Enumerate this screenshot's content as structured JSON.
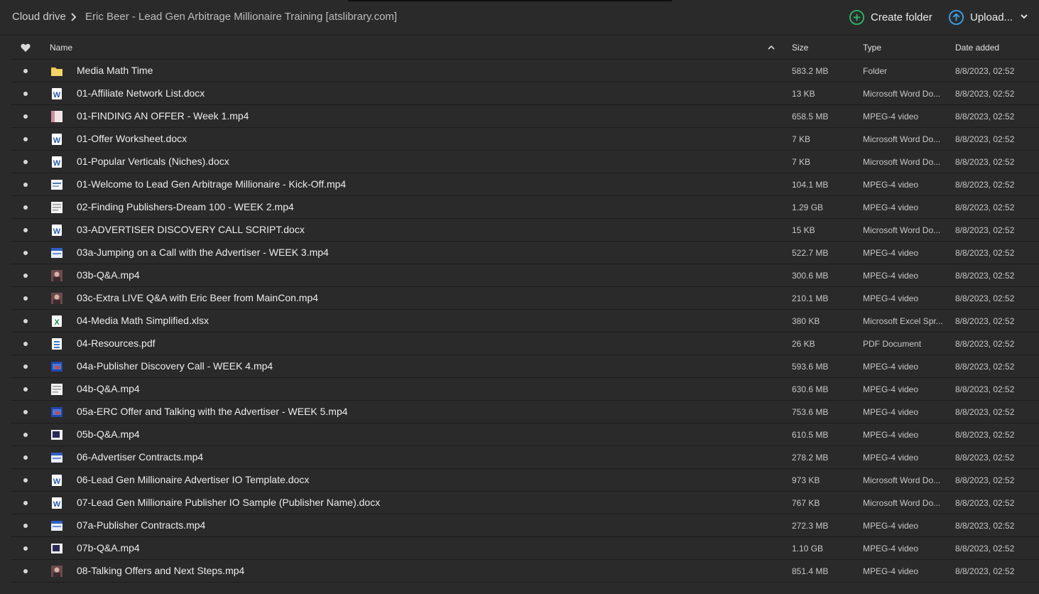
{
  "breadcrumb": {
    "root": "Cloud drive",
    "current": "Eric Beer - Lead Gen Arbitrage Millionaire Training [atslibrary.com]"
  },
  "actions": {
    "create_folder": "Create folder",
    "upload": "Upload...",
    "create_color": "#2db36b",
    "upload_color": "#3aa0e8"
  },
  "columns": {
    "name": "Name",
    "size": "Size",
    "type": "Type",
    "date": "Date added"
  },
  "files": [
    {
      "name": "Media Math Time",
      "size": "583.2 MB",
      "type": "Folder",
      "date": "8/8/2023, 02:52",
      "icon": "folder"
    },
    {
      "name": "01-Affiliate Network List.docx",
      "size": "13 KB",
      "type": "Microsoft Word Do...",
      "date": "8/8/2023, 02:52",
      "icon": "word"
    },
    {
      "name": "01-FINDING AN OFFER - Week 1.mp4",
      "size": "658.5 MB",
      "type": "MPEG-4 video",
      "date": "8/8/2023, 02:52",
      "icon": "video-pink"
    },
    {
      "name": "01-Offer Worksheet.docx",
      "size": "7 KB",
      "type": "Microsoft Word Do...",
      "date": "8/8/2023, 02:52",
      "icon": "word"
    },
    {
      "name": "01-Popular Verticals (Niches).docx",
      "size": "7 KB",
      "type": "Microsoft Word Do...",
      "date": "8/8/2023, 02:52",
      "icon": "word"
    },
    {
      "name": "01-Welcome to Lead Gen Arbitrage Millionaire - Kick-Off.mp4",
      "size": "104.1 MB",
      "type": "MPEG-4 video",
      "date": "8/8/2023, 02:52",
      "icon": "video-slide"
    },
    {
      "name": "02-Finding Publishers-Dream 100 - WEEK 2.mp4",
      "size": "1.29 GB",
      "type": "MPEG-4 video",
      "date": "8/8/2023, 02:52",
      "icon": "video-doc"
    },
    {
      "name": "03-ADVERTISER DISCOVERY CALL SCRIPT.docx",
      "size": "15 KB",
      "type": "Microsoft Word Do...",
      "date": "8/8/2023, 02:52",
      "icon": "word"
    },
    {
      "name": "03a-Jumping on a Call with the Advertiser - WEEK 3.mp4",
      "size": "522.7 MB",
      "type": "MPEG-4 video",
      "date": "8/8/2023, 02:52",
      "icon": "video-blue"
    },
    {
      "name": "03b-Q&A.mp4",
      "size": "300.6 MB",
      "type": "MPEG-4 video",
      "date": "8/8/2023, 02:52",
      "icon": "video-person"
    },
    {
      "name": "03c-Extra LIVE Q&A with Eric Beer from MainCon.mp4",
      "size": "210.1 MB",
      "type": "MPEG-4 video",
      "date": "8/8/2023, 02:52",
      "icon": "video-person"
    },
    {
      "name": "04-Media Math Simplified.xlsx",
      "size": "380 KB",
      "type": "Microsoft Excel Spr...",
      "date": "8/8/2023, 02:52",
      "icon": "excel"
    },
    {
      "name": "04-Resources.pdf",
      "size": "26 KB",
      "type": "PDF Document",
      "date": "8/8/2023, 02:52",
      "icon": "pdf"
    },
    {
      "name": "04a-Publisher Discovery Call - WEEK 4.mp4",
      "size": "593.6 MB",
      "type": "MPEG-4 video",
      "date": "8/8/2023, 02:52",
      "icon": "video-screen"
    },
    {
      "name": "04b-Q&A.mp4",
      "size": "630.6 MB",
      "type": "MPEG-4 video",
      "date": "8/8/2023, 02:52",
      "icon": "video-doc"
    },
    {
      "name": "05a-ERC Offer and Talking with the Advertiser - WEEK 5.mp4",
      "size": "753.6 MB",
      "type": "MPEG-4 video",
      "date": "8/8/2023, 02:52",
      "icon": "video-screen"
    },
    {
      "name": "05b-Q&A.mp4",
      "size": "610.5 MB",
      "type": "MPEG-4 video",
      "date": "8/8/2023, 02:52",
      "icon": "video-dark"
    },
    {
      "name": "06-Advertiser Contracts.mp4",
      "size": "278.2 MB",
      "type": "MPEG-4 video",
      "date": "8/8/2023, 02:52",
      "icon": "video-blue"
    },
    {
      "name": "06-Lead Gen Millionaire Advertiser IO Template.docx",
      "size": "973 KB",
      "type": "Microsoft Word Do...",
      "date": "8/8/2023, 02:52",
      "icon": "word"
    },
    {
      "name": "07-Lead Gen Millionaire Publisher IO Sample (Publisher Name).docx",
      "size": "767 KB",
      "type": "Microsoft Word Do...",
      "date": "8/8/2023, 02:52",
      "icon": "word"
    },
    {
      "name": "07a-Publisher Contracts.mp4",
      "size": "272.3 MB",
      "type": "MPEG-4 video",
      "date": "8/8/2023, 02:52",
      "icon": "video-blue"
    },
    {
      "name": "07b-Q&A.mp4",
      "size": "1.10 GB",
      "type": "MPEG-4 video",
      "date": "8/8/2023, 02:52",
      "icon": "video-dark"
    },
    {
      "name": "08-Talking Offers and Next Steps.mp4",
      "size": "851.4 MB",
      "type": "MPEG-4 video",
      "date": "8/8/2023, 02:52",
      "icon": "video-person"
    }
  ]
}
